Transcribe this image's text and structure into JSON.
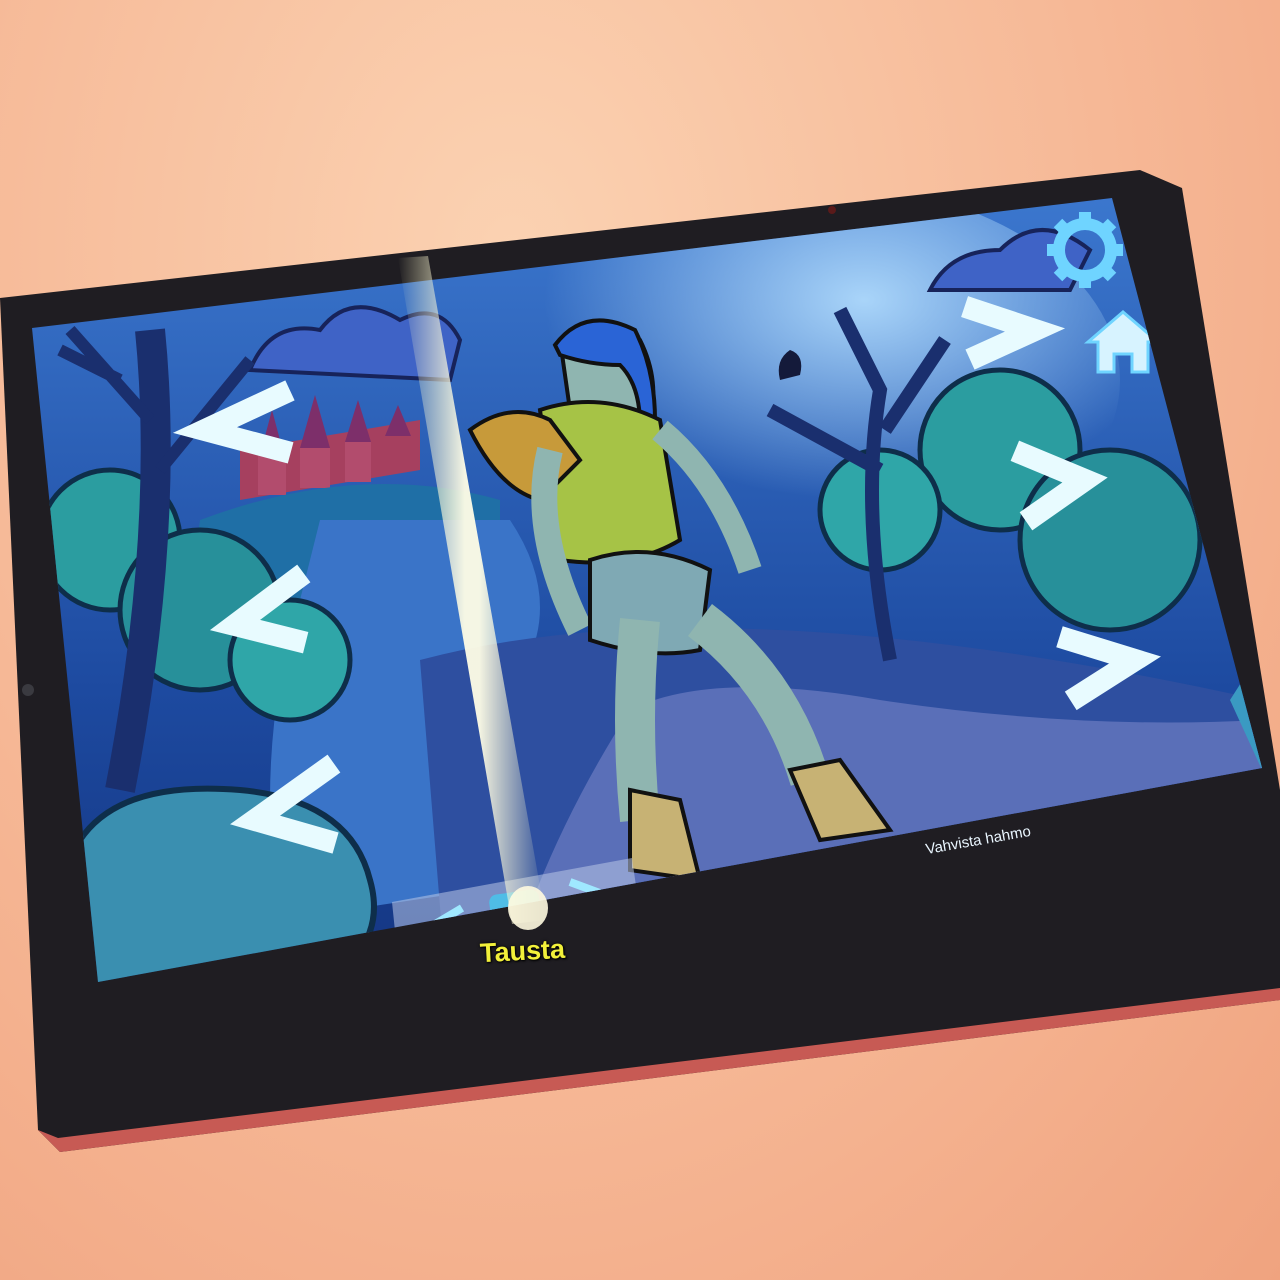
{
  "app": {
    "background_selector_label": "Tausta",
    "confirm_button_label": "Vahvista hahmo"
  },
  "icons": {
    "settings": "gear-icon",
    "home": "home-icon",
    "left_arrows": "chevron-left-icon",
    "right_arrows": "chevron-right-icon"
  },
  "colors": {
    "accent": "#8ef0ff",
    "label_yellow": "#f2f03a",
    "sky": "#2f63b8",
    "tree_teal": "#2a8f9a",
    "character_top": "#9cb94a"
  }
}
